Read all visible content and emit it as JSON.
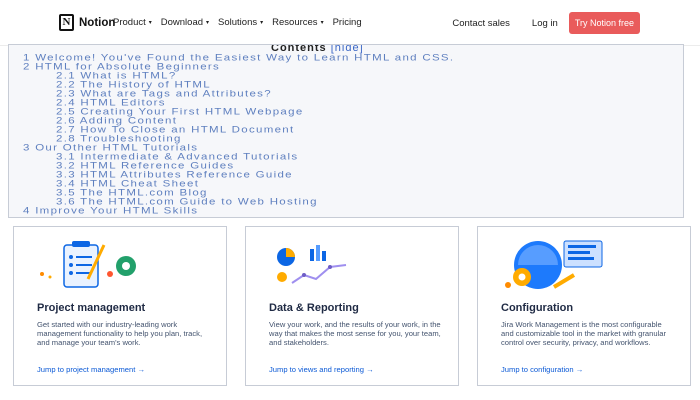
{
  "nav": {
    "brand": "Notion",
    "brand_mark": "N",
    "menu": [
      "Product",
      "Download",
      "Solutions",
      "Resources"
    ],
    "pricing": "Pricing",
    "contact_sales": "Contact sales",
    "log_in": "Log in",
    "try_free": "Try Notion free",
    "accent": "#e95b5b"
  },
  "toc": {
    "title": "Contents",
    "hide": "[hide]",
    "items": [
      "1 Welcome! You've Found the Easiest Way to Learn HTML and CSS.",
      "2 HTML for Absolute Beginners",
      "2.1 What is HTML?",
      "2.2 The History of HTML",
      "2.3 What are Tags and Attributes?",
      "2.4 HTML Editors",
      "2.5 Creating Your First HTML Webpage",
      "2.6 Adding Content",
      "2.7 How To Close an HTML Document",
      "2.8 Troubleshooting",
      "3 Our Other HTML Tutorials",
      "3.1 Intermediate & Advanced Tutorials",
      "3.2 HTML Reference Guides",
      "3.3 HTML Attributes Reference Guide",
      "3.4 HTML Cheat Sheet",
      "3.5 The HTML.com Blog",
      "3.6 The HTML.com Guide to Web Hosting",
      "4 Improve Your HTML Skills"
    ]
  },
  "cards": [
    {
      "title": "Project management",
      "desc": "Get started with our industry-leading work management functionality to help you plan, track, and manage your team's work.",
      "link": "Jump to project management →",
      "icon": "clipboard-gear-icon"
    },
    {
      "title": "Data & Reporting",
      "desc": "View your work, and the results of your work, in the way that makes the most sense for you, your team, and stakeholders.",
      "link": "Jump to views and reporting →",
      "icon": "chart-icon"
    },
    {
      "title": "Configuration",
      "desc": "Jira Work Management is the most configurable and customizable tool in the market with granular control over security, privacy, and workflows.",
      "link": "Jump to configuration →",
      "icon": "globe-gear-icon"
    }
  ]
}
